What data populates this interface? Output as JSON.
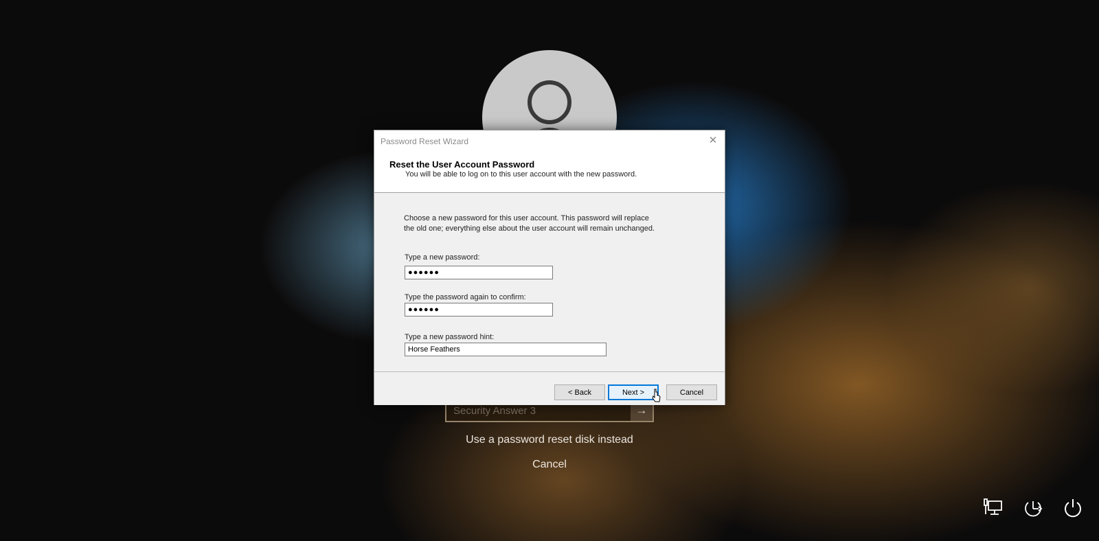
{
  "lockscreen": {
    "security_answer_placeholder": "Security Answer 3",
    "submit_arrow": "→",
    "reset_disk_link": "Use a password reset disk instead",
    "cancel_link": "Cancel",
    "icons": [
      "network-icon",
      "ease-of-access-icon",
      "power-icon"
    ]
  },
  "dialog": {
    "window_title": "Password Reset Wizard",
    "close_glyph": "✕",
    "heading": "Reset the User Account Password",
    "subheading": "You will be able to log on to this user account with the new password.",
    "intro_line1": "Choose a new password for this user account.  This password will replace",
    "intro_line2": "the old one; everything else about the user account will remain unchanged.",
    "new_password_label": "Type a new password:",
    "new_password_value": "●●●●●●",
    "confirm_password_label": "Type the password again to confirm:",
    "confirm_password_value": "●●●●●●",
    "hint_label": "Type a new password hint:",
    "hint_value": "Horse Feathers",
    "back_button": "< Back",
    "next_button": "Next >",
    "cancel_button": "Cancel"
  },
  "colors": {
    "accent": "#0078d7",
    "dialog_bg": "#f0f0f0"
  }
}
